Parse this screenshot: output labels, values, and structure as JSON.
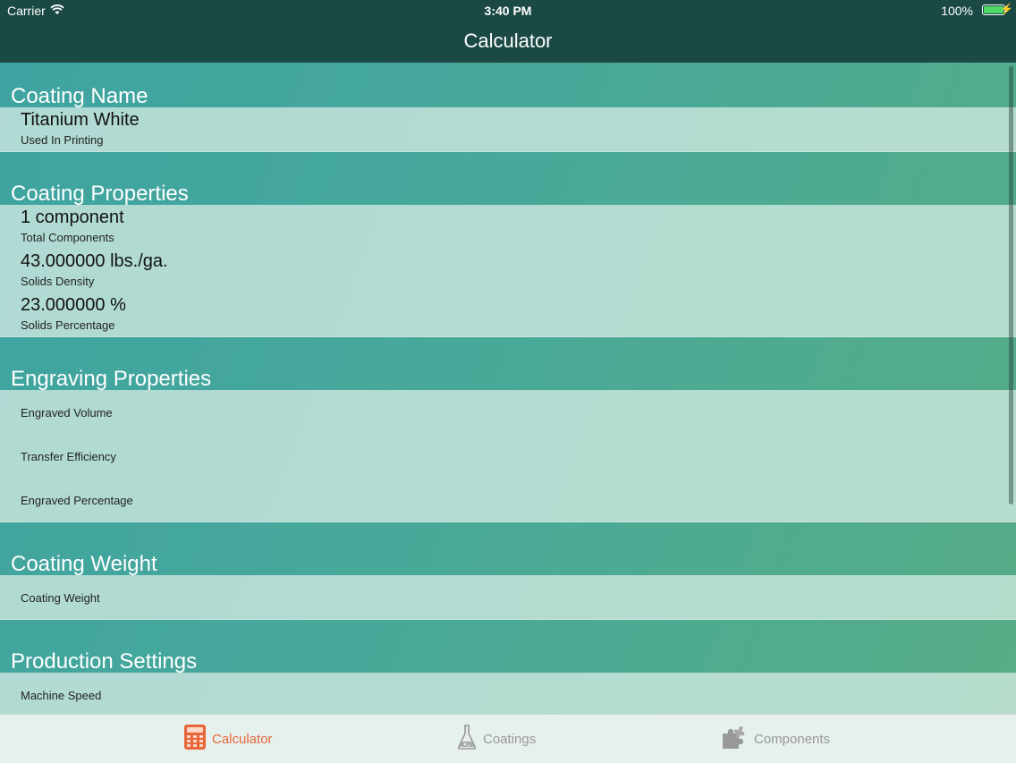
{
  "status": {
    "carrier": "Carrier",
    "time": "3:40 PM",
    "battery": "100%"
  },
  "nav": {
    "title": "Calculator"
  },
  "sections": {
    "coating_name": {
      "header": "Coating Name",
      "rows": [
        {
          "value": "Titanium White",
          "label": "Used In Printing"
        }
      ]
    },
    "coating_properties": {
      "header": "Coating Properties",
      "rows": [
        {
          "value": "1 component",
          "label": "Total Components"
        },
        {
          "value": "43.000000 lbs./ga.",
          "label": "Solids Density"
        },
        {
          "value": "23.000000 %",
          "label": "Solids Percentage"
        }
      ]
    },
    "engraving_properties": {
      "header": "Engraving Properties",
      "rows": [
        {
          "label": "Engraved Volume"
        },
        {
          "label": "Transfer Efficiency"
        },
        {
          "label": "Engraved Percentage"
        }
      ]
    },
    "coating_weight": {
      "header": "Coating Weight",
      "rows": [
        {
          "label": "Coating Weight"
        }
      ]
    },
    "production_settings": {
      "header": "Production Settings",
      "rows": [
        {
          "label": "Machine Speed"
        }
      ]
    }
  },
  "tabs": [
    {
      "label": "Calculator",
      "icon": "calculator-icon",
      "active": true
    },
    {
      "label": "Coatings",
      "icon": "flask-icon",
      "active": false
    },
    {
      "label": "Components",
      "icon": "puzzle-icon",
      "active": false
    }
  ],
  "colors": {
    "accent": "#e8663a",
    "nav": "#1b4a45"
  }
}
